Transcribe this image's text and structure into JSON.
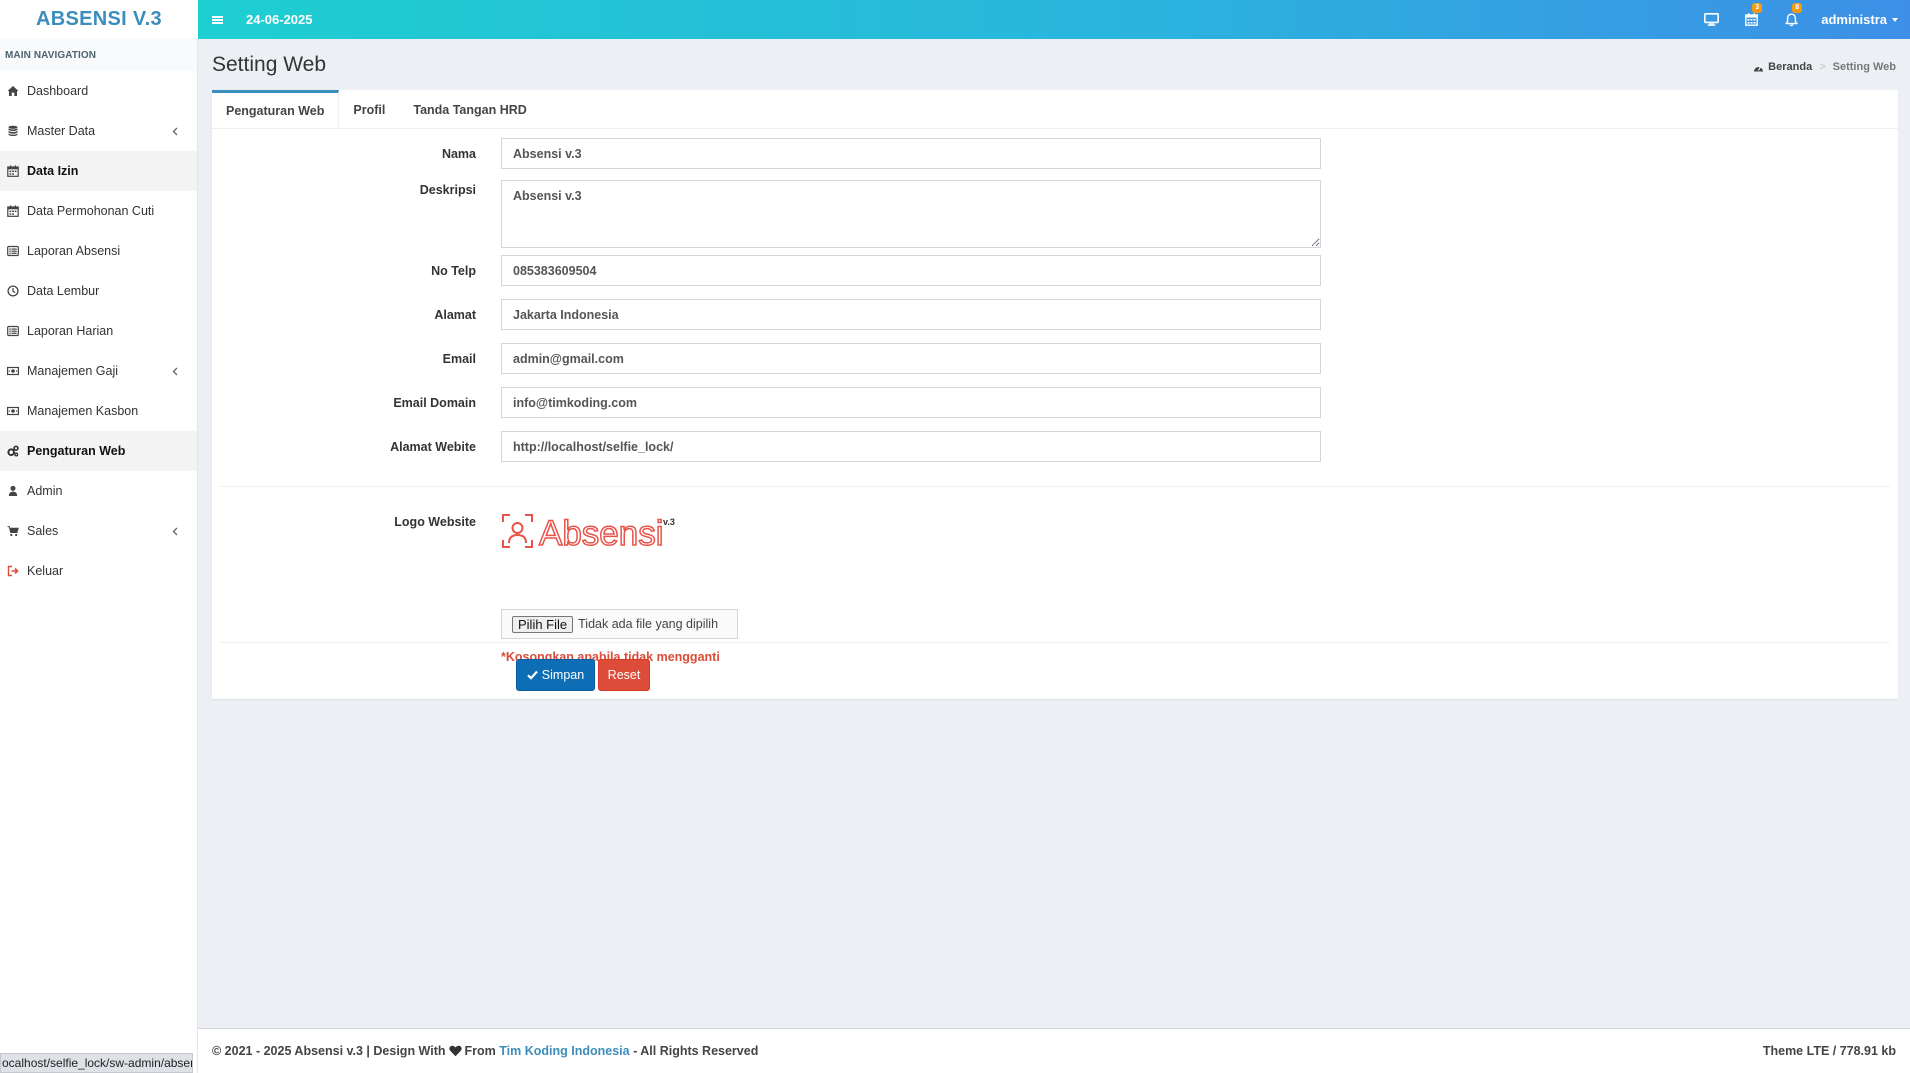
{
  "header": {
    "brand": "ABSENSI V.3",
    "date": "24-06-2025",
    "calendar_badge": "3",
    "bell_badge": "8",
    "user": "administra"
  },
  "sidebar": {
    "section": "MAIN NAVIGATION",
    "items": [
      {
        "label": "Dashboard",
        "icon": "home-icon"
      },
      {
        "label": "Master Data",
        "icon": "database-icon"
      },
      {
        "label": "Data Izin",
        "icon": "calendar-icon"
      },
      {
        "label": "Data Permohonan Cuti",
        "icon": "calendar-icon"
      },
      {
        "label": "Laporan Absensi",
        "icon": "list-alt-icon"
      },
      {
        "label": "Data Lembur",
        "icon": "clock-icon"
      },
      {
        "label": "Laporan Harian",
        "icon": "list-alt-icon"
      },
      {
        "label": "Manajemen Gaji",
        "icon": "money-icon"
      },
      {
        "label": "Manajemen Kasbon",
        "icon": "money-icon"
      },
      {
        "label": "Pengaturan Web",
        "icon": "gears-icon"
      },
      {
        "label": "Admin",
        "icon": "user-icon"
      },
      {
        "label": "Sales",
        "icon": "cart-icon"
      },
      {
        "label": "Keluar",
        "icon": "sign-out-icon"
      }
    ]
  },
  "page": {
    "title": "Setting Web",
    "breadcrumb": {
      "home": "Beranda",
      "current": "Setting Web"
    }
  },
  "tabs": [
    "Pengaturan Web",
    "Profil",
    "Tanda Tangan HRD"
  ],
  "form": {
    "nama": {
      "label": "Nama",
      "value": "Absensi v.3"
    },
    "deskripsi": {
      "label": "Deskripsi",
      "value": "Absensi v.3"
    },
    "telp": {
      "label": "No Telp",
      "value": "085383609504"
    },
    "alamat": {
      "label": "Alamat",
      "value": "Jakarta Indonesia"
    },
    "email": {
      "label": "Email",
      "value": "admin@gmail.com"
    },
    "email_domain": {
      "label": "Email Domain",
      "value": "info@timkoding.com"
    },
    "website": {
      "label": "Alamat Webite",
      "value": "http://localhost/selfie_lock/"
    },
    "logo": {
      "label": "Logo Website",
      "logo_text": "Absensi",
      "logo_version": "v.3"
    },
    "file": {
      "button": "Pilih File",
      "text": "Tidak ada file yang dipilih"
    },
    "hint": "*Kosongkan apabila tidak mengganti"
  },
  "buttons": {
    "save": "Simpan",
    "reset": "Reset"
  },
  "footer": {
    "left_prefix": "© 2021 - 2025 Absensi v.3 | Design With",
    "left_from": "From",
    "link": "Tim Koding Indonesia",
    "left_suffix": "- All Rights Reserved",
    "right": "Theme LTE / 778.91 kb"
  },
  "status_url": "ocalhost/selfie_lock/sw-admin/absensi",
  "colors": {
    "accent": "#3c8dbc",
    "danger": "#dd4b39",
    "primary": "#0e6eb5",
    "logo": "#e8534a"
  }
}
